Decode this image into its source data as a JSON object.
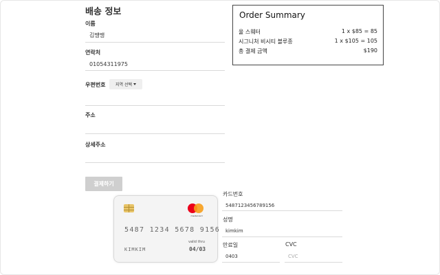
{
  "shipping": {
    "title": "배송 정보",
    "name_label": "이름",
    "name_value": "김땡땡",
    "phone_label": "연락처",
    "phone_value": "01054311975",
    "postal_label": "우편번호",
    "region_select": "지역 선택",
    "address_label": "주소",
    "address_value": "",
    "detail_address_label": "상세주소",
    "detail_address_value": "",
    "pay_button": "결제하기"
  },
  "order_summary": {
    "title": "Order Summary",
    "items": [
      {
        "name": "울 스웨터",
        "price": "1 x $85 = 85"
      },
      {
        "name": "시그니처 비시티 블루종",
        "price": "1 x $105 = 105"
      }
    ],
    "total_label": "총 결제 금액",
    "total_value": "$190"
  },
  "card_preview": {
    "number": "5487 1234 5678 9156",
    "holder": "KIMKIM",
    "valid_label": "valid thru",
    "expiry": "04/03",
    "brand_text": "mastercard"
  },
  "payment_form": {
    "card_number_label": "카드번호",
    "card_number_value": "5487123456789156",
    "name_label": "성명",
    "name_value": "kimkim",
    "expiry_label": "만료일",
    "expiry_value": "0403",
    "cvc_label": "CVC",
    "cvc_placeholder": "CVC"
  },
  "colors": {
    "button_disabled": "#cfcfcf",
    "mastercard_red": "#eb001b",
    "mastercard_yellow": "#f79e1b",
    "chip_gold": "#e8c468"
  }
}
